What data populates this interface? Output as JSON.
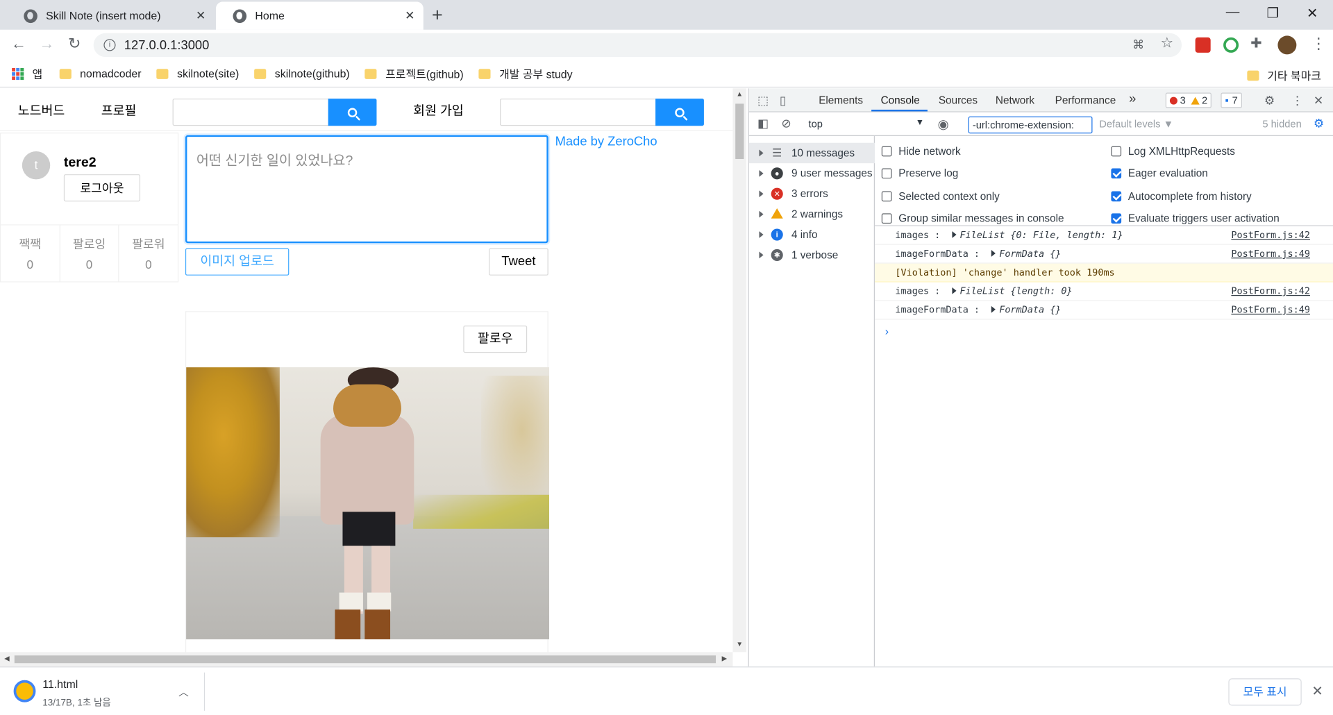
{
  "browser": {
    "tabs": [
      {
        "title": "Skill Note (insert mode)",
        "active": false
      },
      {
        "title": "Home",
        "active": true
      }
    ],
    "new_tab": "+",
    "window_controls": {
      "minimize": "—",
      "restore": "❐",
      "close": "✕"
    },
    "url": "127.0.0.1:3000",
    "bookmarks": [
      {
        "label": "앱",
        "icon": "apps-icon"
      },
      {
        "label": "nomadcoder",
        "icon": "folder-icon"
      },
      {
        "label": "skilnote(site)",
        "icon": "folder-icon"
      },
      {
        "label": "skilnote(github)",
        "icon": "folder-icon"
      },
      {
        "label": "프로젝트(github)",
        "icon": "folder-icon"
      },
      {
        "label": "개발 공부 study",
        "icon": "folder-icon"
      }
    ],
    "other_bookmarks": "기타 북마크"
  },
  "page": {
    "menu": {
      "home": "노드버드",
      "profile": "프로필",
      "signup": "회원 가입"
    },
    "user": {
      "avatar_letter": "t",
      "nickname": "tere2",
      "logout": "로그아웃"
    },
    "stats": [
      {
        "label": "짹짹",
        "value": "0"
      },
      {
        "label": "팔로잉",
        "value": "0"
      },
      {
        "label": "팔로워",
        "value": "0"
      }
    ],
    "post_form": {
      "placeholder": "어떤 신기한 일이 있었나요?",
      "upload": "이미지 업로드",
      "submit": "Tweet"
    },
    "made_by": "Made by ZeroCho",
    "post": {
      "follow": "팔로우"
    }
  },
  "devtools": {
    "tabs": [
      "Elements",
      "Console",
      "Sources",
      "Network",
      "Performance"
    ],
    "active_tab": "Console",
    "more": "»",
    "errors": "3",
    "warnings": "2",
    "messages_badge": "7",
    "context": "top",
    "filter": "-url:chrome-extension:",
    "levels": "Default levels ▼",
    "hidden": "5 hidden",
    "sidebar": [
      {
        "label": "10 messages",
        "icon": "list-icon",
        "color": "#5f6368"
      },
      {
        "label": "9 user messages",
        "icon": "user-icon",
        "color": "#3c4043"
      },
      {
        "label": "3 errors",
        "icon": "error-icon",
        "color": "#d93025"
      },
      {
        "label": "2 warnings",
        "icon": "warning-icon",
        "color": "#f0a30a"
      },
      {
        "label": "4 info",
        "icon": "info-icon",
        "color": "#1a73e8"
      },
      {
        "label": "1 verbose",
        "icon": "bug-icon",
        "color": "#5f6368"
      }
    ],
    "settings_left": [
      {
        "label": "Hide network",
        "checked": false
      },
      {
        "label": "Preserve log",
        "checked": false
      },
      {
        "label": "Selected context only",
        "checked": false
      },
      {
        "label": "Group similar messages in console",
        "checked": false
      }
    ],
    "settings_right": [
      {
        "label": "Log XMLHttpRequests",
        "checked": false
      },
      {
        "label": "Eager evaluation",
        "checked": true
      },
      {
        "label": "Autocomplete from history",
        "checked": true
      },
      {
        "label": "Evaluate triggers user activation",
        "checked": true
      }
    ],
    "logs": [
      {
        "key": "images :",
        "value": "FileList {0: File, length: 1}",
        "source": "PostForm.js:42"
      },
      {
        "key": "imageFormData :",
        "value": "FormData {}",
        "source": "PostForm.js:49"
      },
      {
        "violation": "[Violation] 'change' handler took 190ms"
      },
      {
        "key": "images :",
        "value": "FileList {length: 0}",
        "source": "PostForm.js:42"
      },
      {
        "key": "imageFormData :",
        "value": "FormData {}",
        "source": "PostForm.js:49"
      }
    ],
    "prompt": "›"
  },
  "download": {
    "file": "11.html",
    "status": "13/17B, 1초 남음",
    "show_all": "모두 표시"
  }
}
